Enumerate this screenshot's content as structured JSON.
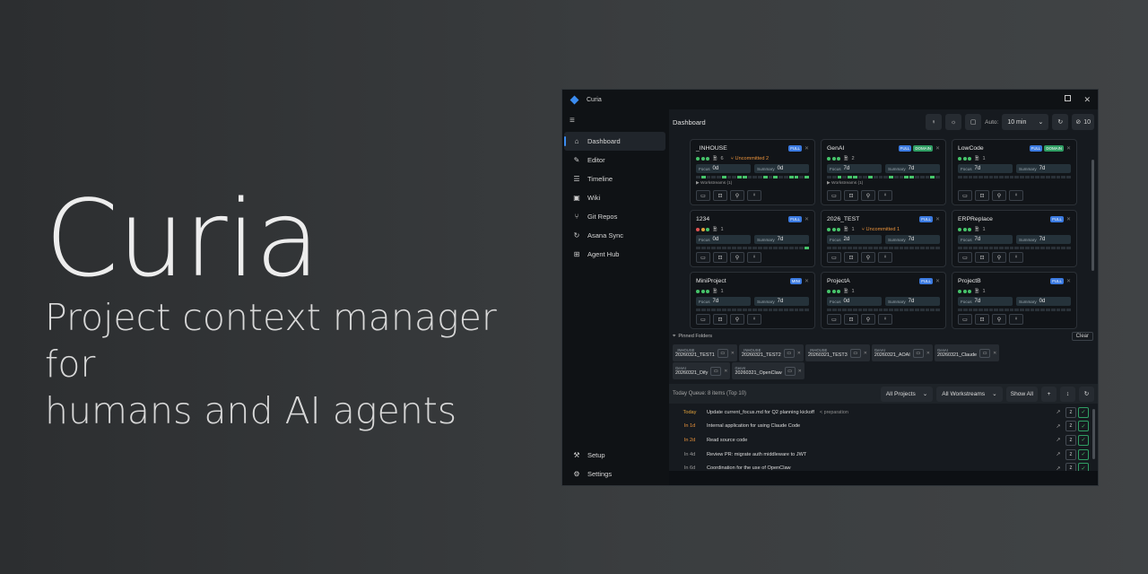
{
  "hero": {
    "title": "Curia",
    "subtitle_line1": "Project context manager for",
    "subtitle_line2": "humans and AI agents"
  },
  "window": {
    "title": "Curia",
    "accent": "#3b8cf0"
  },
  "sidebar": {
    "items": [
      {
        "label": "Dashboard",
        "icon": "home-icon",
        "glyph": "⌂",
        "active": true
      },
      {
        "label": "Editor",
        "icon": "edit-icon",
        "glyph": "✎"
      },
      {
        "label": "Timeline",
        "icon": "timeline-icon",
        "glyph": "☰"
      },
      {
        "label": "Wiki",
        "icon": "book-icon",
        "glyph": "▣"
      },
      {
        "label": "Git Repos",
        "icon": "git-branch-icon",
        "glyph": "⑂"
      },
      {
        "label": "Asana Sync",
        "icon": "sync-icon",
        "glyph": "↻"
      },
      {
        "label": "Agent Hub",
        "icon": "robot-icon",
        "glyph": "⊞"
      }
    ],
    "bottom": [
      {
        "label": "Setup",
        "icon": "wrench-icon",
        "glyph": "⚒"
      },
      {
        "label": "Settings",
        "icon": "gear-icon",
        "glyph": "⚙"
      }
    ]
  },
  "topbar": {
    "title": "Dashboard",
    "auto_label": "Auto:",
    "auto_value": "10 min",
    "hide_count": "10"
  },
  "projects": [
    {
      "name": "_INHOUSE",
      "badges": [
        "FULL"
      ],
      "dots": [
        "green",
        "green",
        "green"
      ],
      "files": "6",
      "uncommitted": "Uncommitted 2",
      "focus": "0d",
      "summary": "0d",
      "workstreams": "Workstreams (1)"
    },
    {
      "name": "GenAI",
      "badges": [
        "FULL",
        "DOMAIN"
      ],
      "dots": [
        "green",
        "green",
        "green"
      ],
      "files": "2",
      "uncommitted": "",
      "focus": "7d",
      "summary": "7d",
      "workstreams": "Workstreams (1)"
    },
    {
      "name": "LowCode",
      "badges": [
        "FULL",
        "DOMAIN"
      ],
      "dots": [
        "green",
        "green",
        "green"
      ],
      "files": "1",
      "uncommitted": "",
      "focus": "7d",
      "summary": "7d",
      "workstreams": ""
    },
    {
      "name": "1234",
      "badges": [
        "FULL"
      ],
      "dots": [
        "red",
        "amber",
        "green"
      ],
      "files": "1",
      "uncommitted": "",
      "focus": "0d",
      "summary": "7d",
      "workstreams": ""
    },
    {
      "name": "2026_TEST",
      "badges": [
        "FULL"
      ],
      "dots": [
        "green",
        "green",
        "green"
      ],
      "files": "1",
      "uncommitted": "Uncommitted 1",
      "focus": "2d",
      "summary": "7d",
      "workstreams": ""
    },
    {
      "name": "ERPReplace",
      "badges": [
        "FULL"
      ],
      "dots": [
        "green",
        "green",
        "green"
      ],
      "files": "1",
      "uncommitted": "",
      "focus": "7d",
      "summary": "7d",
      "workstreams": ""
    },
    {
      "name": "MiniProject",
      "badges": [
        "MINI"
      ],
      "dots": [
        "green",
        "green",
        "green"
      ],
      "files": "1",
      "uncommitted": "",
      "focus": "7d",
      "summary": "7d",
      "workstreams": ""
    },
    {
      "name": "ProjectA",
      "badges": [
        "FULL"
      ],
      "dots": [
        "green",
        "green",
        "green"
      ],
      "files": "1",
      "uncommitted": "",
      "focus": "0d",
      "summary": "7d",
      "workstreams": ""
    },
    {
      "name": "ProjectB",
      "badges": [
        "FULL"
      ],
      "dots": [
        "green",
        "green",
        "green"
      ],
      "files": "1",
      "uncommitted": "",
      "focus": "7d",
      "summary": "0d",
      "workstreams": ""
    }
  ],
  "labels": {
    "focus": "Focus",
    "summary": "Summary"
  },
  "pinned": {
    "title": "Pinned Folders",
    "clear": "Clear",
    "chips": [
      {
        "project": "_INHOUSE",
        "folder": "20260321_TEST1"
      },
      {
        "project": "_INHOUSE",
        "folder": "20260321_TEST2"
      },
      {
        "project": "_INHOUSE",
        "folder": "20260321_TEST3"
      },
      {
        "project": "GenAI",
        "folder": "20260321_AOAI"
      },
      {
        "project": "GenAI",
        "folder": "20260321_Claude"
      },
      {
        "project": "GenAI",
        "folder": "20260321_Dify"
      },
      {
        "project": "GenAI",
        "folder": "20260321_OpenClaw"
      }
    ]
  },
  "queue": {
    "title": "Today Queue: 8 items (Top 10)",
    "filter_projects": "All Projects",
    "filter_workstreams": "All Workstreams",
    "show_all": "Show All",
    "rows": [
      {
        "when": "Today",
        "kind": "today",
        "task": "Update current_focus.md for Q2 planning kickoff",
        "tag": "< preparation"
      },
      {
        "when": "In 1d",
        "kind": "soon",
        "task": "Internal application for using Claude Code",
        "tag": ""
      },
      {
        "when": "In 2d",
        "kind": "soon",
        "task": "Read source code",
        "tag": ""
      },
      {
        "when": "In 4d",
        "kind": "later",
        "task": "Review PR: migrate auth middleware to JWT",
        "tag": ""
      },
      {
        "when": "In 6d",
        "kind": "later",
        "task": "Coordination for the use of OpenClaw",
        "tag": ""
      }
    ]
  }
}
